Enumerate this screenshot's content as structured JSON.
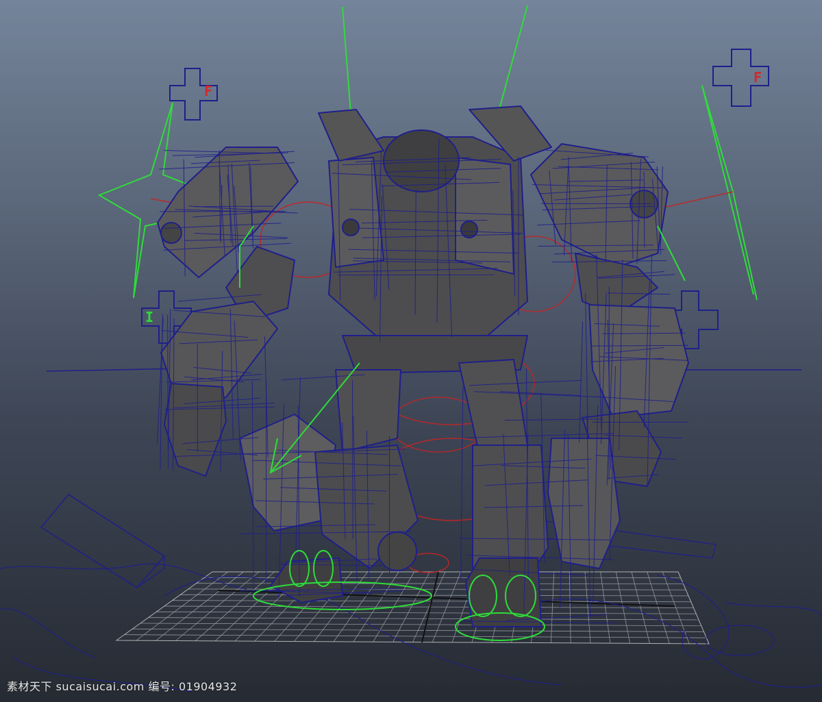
{
  "viewport": {
    "background_top": "#74849a",
    "background_bottom": "#262b33",
    "wire_color": "#1f1f8a",
    "mesh_fill": "#4a4a4a",
    "controller_green": "#2fdc3a",
    "controller_red": "#d02a2a",
    "grid_color": "#c8c8c8"
  },
  "controls": {
    "cross_top_left_letter": "F",
    "cross_top_right_letter": "F",
    "cross_left_letter": "I"
  },
  "watermark": {
    "text": "素材天下 sucaisucai.com  编号: 01904932"
  }
}
